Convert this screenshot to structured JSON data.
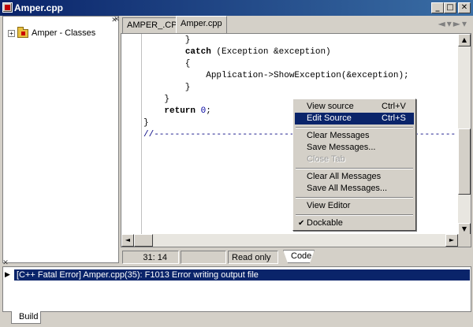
{
  "window": {
    "title": "Amper.cpp"
  },
  "tree": {
    "root_label": "Amper - Classes",
    "expander": "+"
  },
  "tabs": [
    {
      "label": "AMPER_.CPP"
    },
    {
      "label": "Amper.cpp"
    }
  ],
  "code": {
    "lines": [
      {
        "text": "        }"
      },
      {
        "kw": "catch",
        "text": " (Exception &exception)"
      },
      {
        "text": "        {"
      },
      {
        "text": "            Application->ShowException(&exception);"
      },
      {
        "text": "        }"
      },
      {
        "text": "    }"
      },
      {
        "kw": "return",
        "num": "0",
        "text": ";"
      },
      {
        "text": "}"
      },
      {
        "comment": "//---------------------------------------------------------------------------"
      }
    ]
  },
  "status": {
    "position": "31: 14",
    "mode": "Read only",
    "tab": "Code"
  },
  "messages": [
    {
      "text": "[C++ Fatal Error] Amper.cpp(35): F1013 Error writing output file"
    }
  ],
  "bottom_tab": {
    "label": "Build"
  },
  "context_menu": {
    "items": [
      {
        "label": "View source",
        "shortcut": "Ctrl+V"
      },
      {
        "label": "Edit Source",
        "shortcut": "Ctrl+S"
      },
      {
        "label": "Clear Messages"
      },
      {
        "label": "Save Messages..."
      },
      {
        "label": "Close Tab"
      },
      {
        "label": "Clear All Messages"
      },
      {
        "label": "Save All Messages..."
      },
      {
        "label": "View Editor"
      },
      {
        "label": "Dockable",
        "checkmark": "✔"
      }
    ]
  }
}
